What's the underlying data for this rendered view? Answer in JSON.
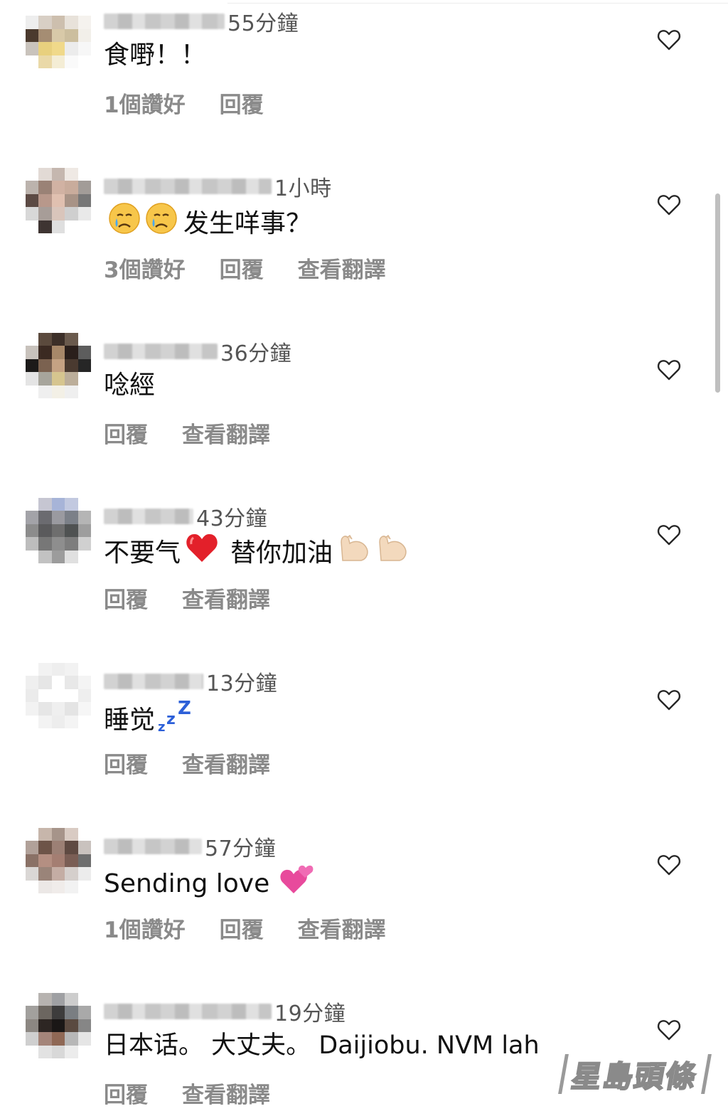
{
  "comments": [
    {
      "time": "55分鐘",
      "text": "食嘢！！",
      "likes": "1個讚好",
      "reply": "回覆",
      "translate": "",
      "emojis": [],
      "avatar_colors": [
        "#ffffff",
        "#ffffff",
        "#ffffff",
        "#ffffff",
        "#ffffff",
        "#eeeeee",
        "#d8cfc5",
        "#cdbfae",
        "#e8e2da",
        "#f5f2ee",
        "#4b3a2e",
        "#a58d73",
        "#d8c9a8",
        "#ccbe9e",
        "#f2efe9",
        "#c9c3bc",
        "#e8d07e",
        "#f0d98a",
        "#ececec",
        "#f7f7f7",
        "#ffffff",
        "#ead9a8",
        "#f4edd5",
        "#fafafa",
        "#ffffff"
      ]
    },
    {
      "time": "1小時",
      "text": "发生咩事？",
      "likes": "3個讚好",
      "reply": "回覆",
      "translate": "查看翻譯",
      "emojis": [
        "crying-face",
        "crying-face"
      ],
      "avatar_colors": [
        "#ffffff",
        "#e2dad5",
        "#c5b7af",
        "#efe9e4",
        "#ffffff",
        "#bcb3ad",
        "#9a8276",
        "#d1b2a3",
        "#c9ac9c",
        "#a29c98",
        "#5c4a44",
        "#b8988b",
        "#e0c0b0",
        "#a89386",
        "#777777",
        "#d8d8d8",
        "#a79d98",
        "#d9c5bb",
        "#cfcfcf",
        "#e9e9e9",
        "#ffffff",
        "#3e3432",
        "#dfdfdf",
        "#ffffff",
        "#ffffff"
      ]
    },
    {
      "time": "36分鐘",
      "text": "唸經",
      "likes": "",
      "reply": "回覆",
      "translate": "查看翻譯",
      "emojis": [],
      "avatar_colors": [
        "#ffffff",
        "#5b4a3d",
        "#3c2f28",
        "#6a5a4d",
        "#ffffff",
        "#c8c2bc",
        "#3b2a22",
        "#a78869",
        "#2a1f1b",
        "#5d5d5d",
        "#1c1a19",
        "#7b6250",
        "#c5a283",
        "#4a3a30",
        "#262626",
        "#e4e4e4",
        "#a7a59c",
        "#d6c58f",
        "#bcae9a",
        "#ffffff",
        "#ffffff",
        "#efefef",
        "#f3f0e6",
        "#efefef",
        "#ffffff"
      ]
    },
    {
      "time": "43分鐘",
      "text": "不要气",
      "text2": "替你加油",
      "likes": "",
      "reply": "回覆",
      "translate": "查看翻譯",
      "emojis": [
        "red-heart",
        "flexed-biceps",
        "flexed-biceps"
      ],
      "avatar_colors": [
        "#ffffff",
        "#c6c6d2",
        "#a7b4d8",
        "#c2c9e0",
        "#ffffff",
        "#a3a3a8",
        "#6b6b70",
        "#9a9aa0",
        "#7b8088",
        "#b5b5b5",
        "#8c8c8c",
        "#5a5a5c",
        "#6e6e6e",
        "#4f5252",
        "#9e9e9e",
        "#bdbdbd",
        "#777777",
        "#8e8e8e",
        "#7d7d7d",
        "#d0d0d0",
        "#ffffff",
        "#c2c2c2",
        "#9c9c9c",
        "#e0e0e0",
        "#ffffff"
      ]
    },
    {
      "time": "13分鐘",
      "text": "睡觉",
      "likes": "",
      "reply": "回覆",
      "translate": "查看翻譯",
      "emojis": [
        "zzz"
      ],
      "avatar_colors": [
        "#ffffff",
        "#f2f2f2",
        "#eeeeee",
        "#f2f2f2",
        "#ffffff",
        "#efefef",
        "#e6e6e6",
        "#ffffff",
        "#e8e8e8",
        "#f4f4f4",
        "#ebebeb",
        "#ffffff",
        "#ffffff",
        "#ffffff",
        "#eeeeee",
        "#f2f2f2",
        "#e6e6e6",
        "#efefef",
        "#e4e4e4",
        "#f6f6f6",
        "#ffffff",
        "#f3f3f3",
        "#ededed",
        "#f4f4f4",
        "#ffffff"
      ]
    },
    {
      "time": "57分鐘",
      "text": "Sending love",
      "likes": "1個讚好",
      "reply": "回覆",
      "translate": "查看翻譯",
      "emojis": [
        "revolving-hearts"
      ],
      "avatar_colors": [
        "#ffffff",
        "#c7b6ab",
        "#a6948a",
        "#d9cbc3",
        "#ffffff",
        "#b1a199",
        "#6d5448",
        "#9c8075",
        "#5f4a42",
        "#c9c2be",
        "#8a7166",
        "#b48f82",
        "#a47e72",
        "#7a5e55",
        "#6e6e6e",
        "#dad7d5",
        "#9a8479",
        "#c4ada4",
        "#d5cfcc",
        "#ececec",
        "#ffffff",
        "#ece8e6",
        "#f0ecea",
        "#f2f2f2",
        "#ffffff"
      ]
    },
    {
      "time": "19分鐘",
      "text": "日本话。 大丈夫。 Daijiobu. NVM lah",
      "likes": "",
      "reply": "回覆",
      "translate": "查看翻譯",
      "emojis": [],
      "avatar_colors": [
        "#ffffff",
        "#b7b3b0",
        "#9fa0a3",
        "#cdcdcd",
        "#ffffff",
        "#a2a09d",
        "#6c6660",
        "#3d3c3c",
        "#7a7e82",
        "#a9a9a9",
        "#8c8782",
        "#2d2623",
        "#1a1716",
        "#5a4a40",
        "#868686",
        "#cfcfcf",
        "#a4857a",
        "#8f6855",
        "#b7b7b7",
        "#e5e5e5",
        "#ffffff",
        "#e2e2e2",
        "#d8d8d8",
        "#ececec",
        "#ffffff"
      ]
    }
  ],
  "watermark": "星島頭條",
  "colors": {
    "action_text": "#8a8a8a",
    "time_text": "#555555",
    "heart_stroke": "#262626"
  }
}
